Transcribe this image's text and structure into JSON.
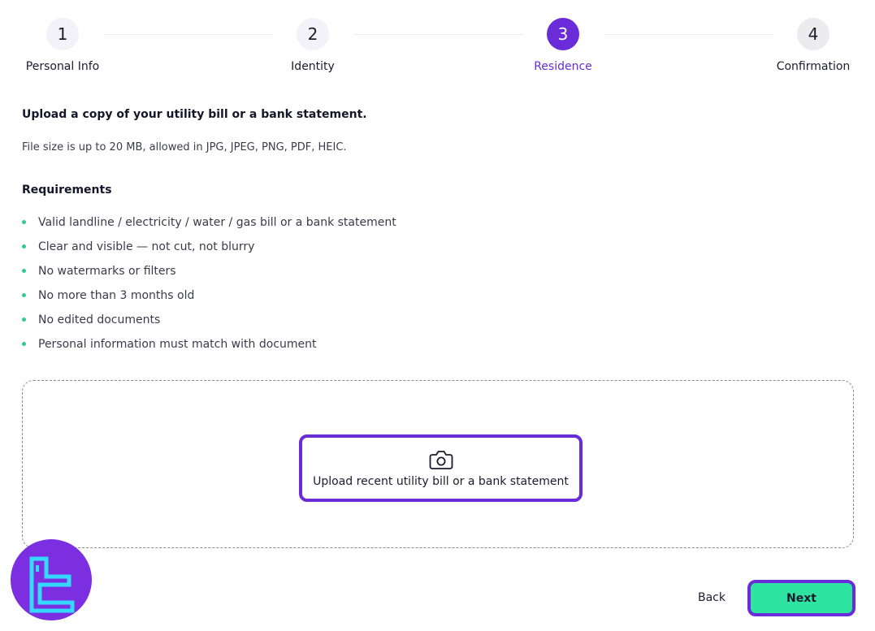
{
  "stepper": {
    "steps": [
      {
        "number": "1",
        "label": "Personal Info",
        "state": "done"
      },
      {
        "number": "2",
        "label": "Identity",
        "state": "done"
      },
      {
        "number": "3",
        "label": "Residence",
        "state": "active"
      },
      {
        "number": "4",
        "label": "Confirmation",
        "state": "future"
      }
    ]
  },
  "upload": {
    "title": "Upload a copy of your utility bill or a bank statement.",
    "subtitle": "File size is up to 20 MB, allowed in JPG, JPEG, PNG, PDF, HEIC.",
    "button_label": "Upload recent utility bill or a bank statement",
    "button_icon": "camera-icon"
  },
  "requirements": {
    "heading": "Requirements",
    "items": [
      "Valid landline / electricity / water / gas bill or a bank statement",
      "Clear and visible — not cut, not blurry",
      "No watermarks or filters",
      "No more than 3 months old",
      "No edited documents",
      "Personal information must match with document"
    ]
  },
  "footer": {
    "back_label": "Back",
    "next_label": "Next"
  },
  "colors": {
    "accent": "#6a2bd9",
    "bullet": "#2ecc8b",
    "next_button": "#2fe3a0",
    "logo_bg": "#7b2fe0",
    "logo_mark": "#35d8ff"
  }
}
